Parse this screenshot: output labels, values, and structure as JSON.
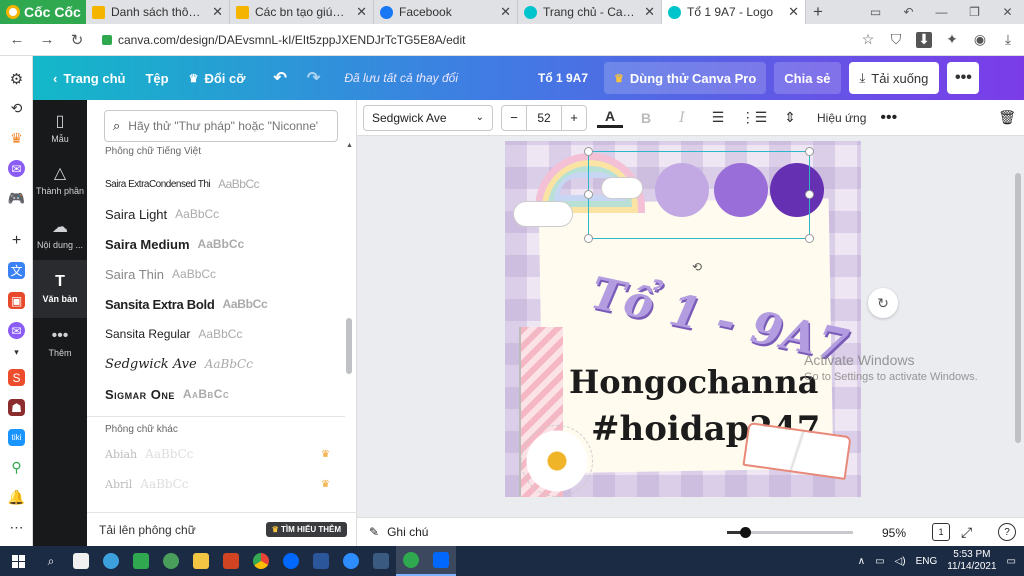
{
  "browser": {
    "brand": "Cốc Cốc",
    "tabs": [
      {
        "title": "Danh sách thông báo",
        "icon_color": "#f4b400",
        "active": false
      },
      {
        "title": "Các bn tạo giúp mik",
        "icon_color": "#f4b400",
        "active": false
      },
      {
        "title": "Facebook",
        "icon_color": "#1877f2",
        "active": false
      },
      {
        "title": "Trang chủ - Canva",
        "icon_color": "#00c4cc",
        "active": false
      },
      {
        "title": "Tổ 1 9A7 - Logo",
        "icon_color": "#00c4cc",
        "active": true
      }
    ],
    "url": "canva.com/design/DAEvsmnL-kI/EIt5zppJXENDJrTcTG5E8A/edit"
  },
  "canva": {
    "header": {
      "home": "Trang chủ",
      "file": "Tệp",
      "resize": "Đổi cỡ",
      "saved_status": "Đã lưu tất cả thay đổi",
      "doc_title": "Tổ 1 9A7",
      "try_pro": "Dùng thử Canva Pro",
      "share": "Chia sẻ",
      "download": "Tải xuống"
    },
    "nav": [
      {
        "label": "Mẫu",
        "icon": "template-icon"
      },
      {
        "label": "Thành phần",
        "icon": "elements-icon"
      },
      {
        "label": "Nội dung ...",
        "icon": "upload-icon"
      },
      {
        "label": "Văn bản",
        "icon": "text-icon",
        "active": true
      },
      {
        "label": "Thêm",
        "icon": "more-icon"
      }
    ],
    "font_panel": {
      "search_placeholder": "Hãy thử \"Thư pháp\" hoặc \"Niconne\"",
      "section_vn": "Phông chữ Tiếng Việt",
      "fonts": [
        {
          "name": "Saira ExtraCondensed Thi",
          "sample": "AaBbCc"
        },
        {
          "name": "Saira Light",
          "sample": "AaBbCc"
        },
        {
          "name": "Saira Medium",
          "sample": "AaBbCc"
        },
        {
          "name": "Saira Thin",
          "sample": "AaBbCc"
        },
        {
          "name": "Sansita Extra Bold",
          "sample": "AaBbCc"
        },
        {
          "name": "Sansita Regular",
          "sample": "AaBbCc"
        },
        {
          "name": "Sedgwick Ave",
          "sample": "AaBbCc"
        },
        {
          "name": "Sigmar One",
          "sample": "AaBbCc"
        }
      ],
      "section_other": "Phông chữ khác",
      "other_fonts": [
        {
          "name": "Abiah",
          "sample": "AaBbCc"
        },
        {
          "name": "Abril",
          "sample": "AaBbCc"
        }
      ],
      "upload_font": "Tải lên phông chữ",
      "learn_more": "TÌM HIỂU THÊM"
    },
    "toolbar": {
      "font": "Sedgwick Ave",
      "size": "52",
      "effects": "Hiệu ứng"
    },
    "design": {
      "headline": "Tổ 1 - 9A7",
      "name": "Hongochanna",
      "tag": "#hoidap247"
    },
    "bottom": {
      "notes": "Ghi chú",
      "zoom": "95%",
      "page_count": "1",
      "zoom_level": 0.14
    },
    "watermark": {
      "title": "Activate Windows",
      "subtitle": "Go to Settings to activate Windows."
    }
  },
  "taskbar": {
    "lang": "ENG",
    "time": "5:53 PM",
    "date": "11/14/2021"
  }
}
